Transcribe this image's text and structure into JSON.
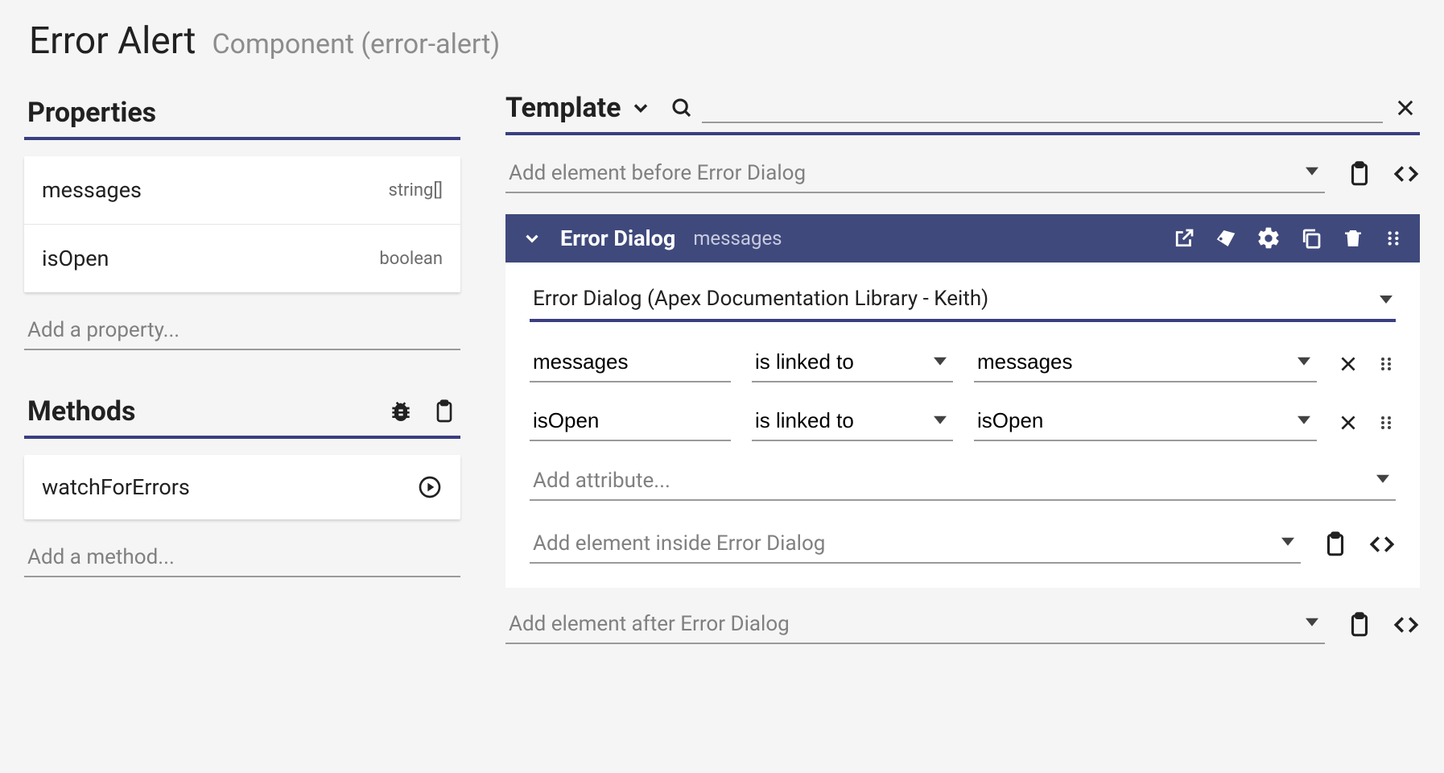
{
  "header": {
    "title": "Error Alert",
    "subtitle": "Component (error-alert)"
  },
  "properties": {
    "section_label": "Properties",
    "items": [
      {
        "name": "messages",
        "type": "string[]"
      },
      {
        "name": "isOpen",
        "type": "boolean"
      }
    ],
    "add_placeholder": "Add a property..."
  },
  "methods": {
    "section_label": "Methods",
    "items": [
      {
        "name": "watchForErrors"
      }
    ],
    "add_placeholder": "Add a method..."
  },
  "template": {
    "section_label": "Template",
    "add_before_placeholder": "Add element before Error Dialog",
    "element": {
      "title": "Error Dialog",
      "chip": "messages",
      "source": "Error Dialog (Apex Documentation Library - Keith)",
      "bindings": [
        {
          "attr": "messages",
          "relation": "is linked to",
          "target": "messages"
        },
        {
          "attr": "isOpen",
          "relation": "is linked to",
          "target": "isOpen"
        }
      ],
      "add_attribute_placeholder": "Add attribute...",
      "add_inside_placeholder": "Add element inside Error Dialog"
    },
    "add_after_placeholder": "Add element after Error Dialog"
  }
}
